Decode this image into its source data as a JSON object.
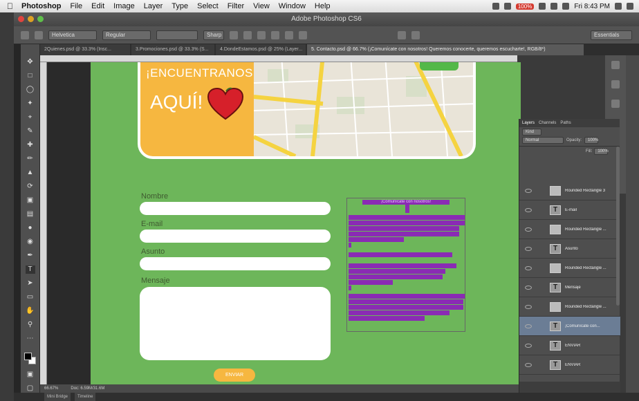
{
  "menubar": {
    "app": "Photoshop",
    "items": [
      "File",
      "Edit",
      "Image",
      "Layer",
      "Type",
      "Select",
      "Filter",
      "View",
      "Window",
      "Help"
    ],
    "battery_badge": "100%",
    "clock": "Fri 8:43 PM"
  },
  "window": {
    "title": "Adobe Photoshop CS6"
  },
  "options": {
    "font_family": "Helvetica",
    "font_style": "Regular",
    "sample": "Sharp",
    "right_label": "Essentials"
  },
  "tabs": [
    "2Quienes.psd @ 33.3% (Insc...",
    "3.Promociones.psd @ 33.3% (S...",
    "4.DondeEstamos.psd @ 25% (Layer...",
    "5. Contacto.psd @ 66.7% (¡Comunícate con nosotros! Queremos conocerte, queremos escucharte!, RGB/8*)"
  ],
  "banner": {
    "line1": "¡ENCUENTRANOS",
    "line2": "AQUÍ!"
  },
  "form": {
    "labels": [
      "Nombre",
      "E-mail",
      "Asunto",
      "Mensaje"
    ],
    "send": "ENVIAR"
  },
  "textbox": {
    "title": "¡Comunícate con nosotros!"
  },
  "status": {
    "zoom": "66.67%",
    "doc": "Doc: 6.59M/31.6M"
  },
  "bottom_tabs": [
    "Mini Bridge",
    "Timeline"
  ],
  "layers_panel": {
    "tabs": [
      "Layers",
      "Channels",
      "Paths"
    ],
    "kind": "Kind",
    "blend": "Normal",
    "opacity_label": "Opacity:",
    "opacity": "100%",
    "fill_label": "Fill:",
    "fill": "100%",
    "rows": [
      {
        "name": "Rounded Rectangle 3",
        "type": "shape"
      },
      {
        "name": "E-mail",
        "type": "text"
      },
      {
        "name": "Rounded Rectangle ...",
        "type": "shape"
      },
      {
        "name": "Asunto",
        "type": "text"
      },
      {
        "name": "Rounded Rectangle ...",
        "type": "shape"
      },
      {
        "name": "Mensaje",
        "type": "text"
      },
      {
        "name": "Rounded Rectangle ...",
        "type": "shape"
      },
      {
        "name": "¡Comunícate con...",
        "type": "text",
        "selected": true
      },
      {
        "name": "ENVIAR",
        "type": "text"
      },
      {
        "name": "ENVIAR",
        "type": "text"
      }
    ]
  }
}
